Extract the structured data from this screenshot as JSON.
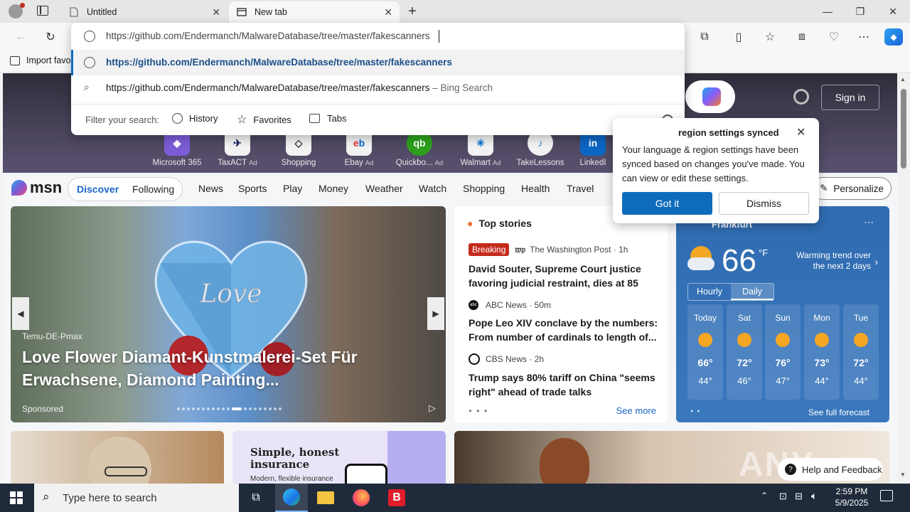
{
  "tabs": [
    {
      "title": "Untitled"
    },
    {
      "title": "New tab"
    }
  ],
  "address": {
    "url": "https://github.com/Endermanch/MalwareDatabase/tree/master/fakescanners"
  },
  "favorites_bar": {
    "import_label": "Import favo"
  },
  "omnibox": {
    "suggestion_url": "https://github.com/Endermanch/MalwareDatabase/tree/master/fakescanners",
    "search_query": "https://github.com/Endermanch/MalwareDatabase/tree/master/fakescanners",
    "search_suffix": "– Bing Search",
    "filter_label": "Filter your search:",
    "filters": [
      "History",
      "Favorites",
      "Tabs"
    ]
  },
  "quick_links": [
    {
      "label": "Microsoft 365",
      "ad": ""
    },
    {
      "label": "TaxACT",
      "ad": "Ad"
    },
    {
      "label": "Shopping",
      "ad": ""
    },
    {
      "label": "Ebay",
      "ad": "Ad"
    },
    {
      "label": "Quickbo...",
      "ad": "Ad"
    },
    {
      "label": "Walmart",
      "ad": "Ad"
    },
    {
      "label": "TakeLessons",
      "ad": ""
    },
    {
      "label": "LinkedI",
      "ad": ""
    }
  ],
  "header": {
    "sign_in": "Sign in"
  },
  "msn_nav": {
    "logo": "msn",
    "discover": "Discover",
    "following": "Following",
    "items": [
      "News",
      "Sports",
      "Play",
      "Money",
      "Weather",
      "Watch",
      "Shopping",
      "Health",
      "Travel"
    ],
    "personalize": "Personalize"
  },
  "carousel": {
    "source": "Temu-DE-Pmax",
    "headline": "Love Flower Diamant-Kunstmalerei-Set Für Erwachsene, Diamond Painting...",
    "sponsored": "Sponsored",
    "heart_text": "Love",
    "dot_count": 20,
    "active_dot": 11
  },
  "top_stories": {
    "title": "Top stories",
    "stories": [
      {
        "badge": "Breaking",
        "source_logo": "wp",
        "source": "The Washington Post · 1h",
        "headline": "David Souter, Supreme Court justice favoring judicial restraint, dies at 85"
      },
      {
        "badge": "",
        "source_logo": "abc",
        "source": "ABC News · 50m",
        "headline": "Pope Leo XIV conclave by the numbers: From number of cardinals to length of..."
      },
      {
        "badge": "",
        "source_logo": "cbs",
        "source": "CBS News · 2h",
        "headline": "Trump says 80% tariff on China \"seems right\" ahead of trade talks"
      }
    ],
    "see_more": "See more"
  },
  "weather": {
    "location": "Frankfurt",
    "temp": "66",
    "unit": "°F",
    "trend": "Warming trend over the next 2 days",
    "tabs": [
      "Hourly",
      "Daily"
    ],
    "days": [
      {
        "name": "Today",
        "hi": "66°",
        "lo": "44°"
      },
      {
        "name": "Sat",
        "hi": "72°",
        "lo": "46°"
      },
      {
        "name": "Sun",
        "hi": "76°",
        "lo": "47°"
      },
      {
        "name": "Mon",
        "hi": "73°",
        "lo": "44°"
      },
      {
        "name": "Tue",
        "hi": "72°",
        "lo": "44°"
      }
    ],
    "see_full": "See full forecast"
  },
  "sync_popup": {
    "title": "region settings synced",
    "body": "Your language & region settings have been synced based on changes you've made. You can view or edit these settings.",
    "got_it": "Got it",
    "dismiss": "Dismiss"
  },
  "bottom_cards": {
    "insurance_title": "Simple, honest insurance",
    "insurance_sub": "Modern, flexible insurance"
  },
  "help": {
    "label": "Help and Feedback"
  },
  "watermark": "ANY RUN",
  "taskbar": {
    "search_placeholder": "Type here to search",
    "time": "2:59 PM",
    "date": "5/9/2025"
  },
  "colors": {
    "accent": "#0f6cbd",
    "msn_blue": "#1a66c9",
    "breaking": "#c42b1c"
  }
}
